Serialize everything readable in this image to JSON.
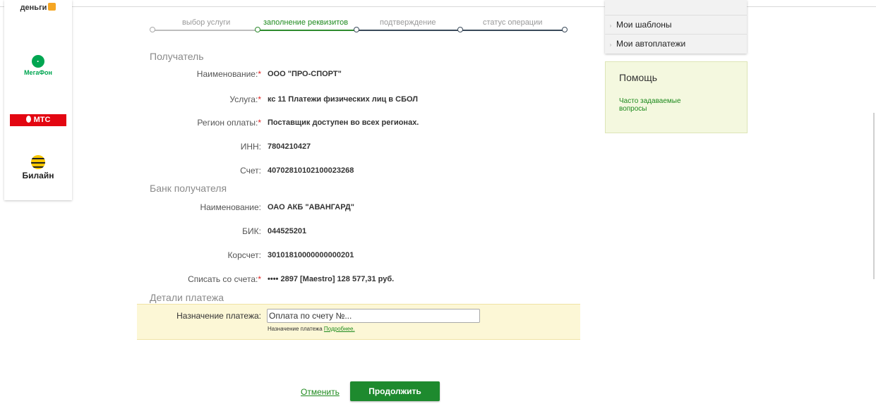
{
  "operators": {
    "dengi": "деньги",
    "megafon": "МегаФон",
    "mts": "МТС",
    "beeline": "Билайн"
  },
  "steps": [
    {
      "label": "выбор услуги",
      "state": "done"
    },
    {
      "label": "заполнение реквизитов",
      "state": "active"
    },
    {
      "label": "подтверждение",
      "state": "pending"
    },
    {
      "label": "статус операции",
      "state": "pending"
    }
  ],
  "recipient": {
    "title": "Получатель",
    "rows": [
      {
        "label": "Наименование:",
        "required": true,
        "value": "ООО \"ПРО-СПОРТ\""
      },
      {
        "label": "Услуга:",
        "required": true,
        "value": "кс 11 Платежи физических лиц в СБОЛ"
      },
      {
        "label": "Регион оплаты:",
        "required": true,
        "value": "Поставщик доступен во всех регионах."
      },
      {
        "label": "ИНН:",
        "required": false,
        "value": "7804210427"
      },
      {
        "label": "Счет:",
        "required": false,
        "value": "40702810102100023268"
      }
    ]
  },
  "bank": {
    "title": "Банк получателя",
    "rows": [
      {
        "label": "Наименование:",
        "required": false,
        "value": "ОАО АКБ \"АВАНГАРД\""
      },
      {
        "label": "БИК:",
        "required": false,
        "value": "044525201"
      },
      {
        "label": "Корсчет:",
        "required": false,
        "value": "30101810000000000201"
      },
      {
        "label": "Списать со счета:",
        "required": true,
        "value": "•••• 2897  [Maestro] 128 577,31  руб."
      }
    ]
  },
  "details": {
    "title": "Детали платежа",
    "purpose_label": "Назначение платежа:",
    "purpose_value": "Оплата по счету №...",
    "hint_text": "Назначение платежа",
    "hint_link": "Подробнее."
  },
  "actions": {
    "cancel": "Отменить",
    "continue": "Продолжить"
  },
  "menu": {
    "items": [
      "Мои шаблоны",
      "Мои автоплатежи"
    ]
  },
  "help": {
    "title": "Помощь",
    "link": "Часто задаваемые вопросы"
  },
  "colors": {
    "accent_green": "#1e8a2e",
    "required_star": "#e02020",
    "details_bg": "#fcf7d6",
    "help_bg": "#f4f8df"
  }
}
